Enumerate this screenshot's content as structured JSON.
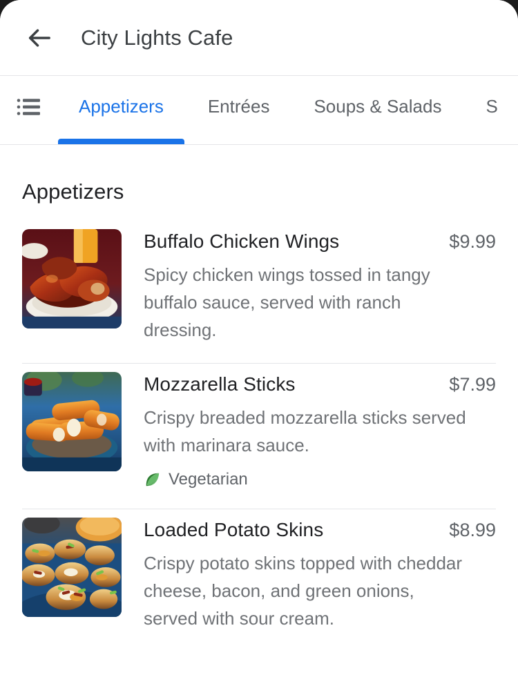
{
  "header": {
    "back_icon": "back-arrow-icon",
    "title": "City Lights Cafe"
  },
  "tab_bar": {
    "list_icon": "list-view-icon",
    "tabs": [
      {
        "label": "Appetizers",
        "active": true
      },
      {
        "label": "Entrées",
        "active": false
      },
      {
        "label": "Soups & Salads",
        "active": false
      },
      {
        "label": "S",
        "active": false
      }
    ],
    "active_color": "#1a73e8",
    "inactive_color": "#5f6368"
  },
  "section": {
    "title": "Appetizers"
  },
  "menu_items": [
    {
      "name": "Buffalo Chicken Wings",
      "price": "$9.99",
      "description": "Spicy chicken wings tossed in tangy buffalo sauce, served with ranch dressing.",
      "image": "buffalo-chicken-wings-photo",
      "tags": []
    },
    {
      "name": "Mozzarella Sticks",
      "price": "$7.99",
      "description": "Crispy breaded mozzarella sticks served with marinara sauce.",
      "image": "mozzarella-sticks-photo",
      "tags": [
        {
          "label": "Vegetarian",
          "icon": "leaf-icon",
          "color": "#4caf50"
        }
      ]
    },
    {
      "name": "Loaded Potato Skins",
      "price": "$8.99",
      "description": "Crispy potato skins topped with cheddar cheese, bacon, and green onions, served with sour cream.",
      "image": "loaded-potato-skins-photo",
      "tags": []
    }
  ]
}
